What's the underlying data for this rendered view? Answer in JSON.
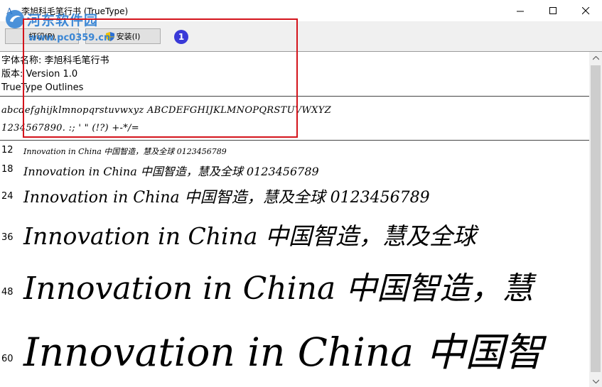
{
  "window": {
    "title": "李旭科毛笔行书 (TrueType)",
    "controls": {
      "minimize": "—",
      "maximize": "☐",
      "close": "✕"
    }
  },
  "watermark": {
    "line1": "河东软件园",
    "line2": "www.pc0359.cn"
  },
  "toolbar": {
    "print_label": "打印(P)",
    "install_label": "安装(I)",
    "badge": "1"
  },
  "font_info": {
    "name_line": "字体名称: 李旭科毛笔行书",
    "version_line": "版本: Version 1.0",
    "type_line": "TrueType Outlines"
  },
  "charset": {
    "line1": "abcdefghijklmnopqrstuvwxyz  ABCDEFGHIJKLMNOPQRSTUVWXYZ",
    "line2": "1234567890.  :;  '  \"  (!?)  +-*/="
  },
  "samples": [
    {
      "size": "12",
      "text": "Innovation in China  中国智造，慧及全球  0123456789"
    },
    {
      "size": "18",
      "text": "Innovation in China  中国智造，慧及全球  0123456789"
    },
    {
      "size": "24",
      "text": "Innovation in China  中国智造，慧及全球  0123456789"
    },
    {
      "size": "36",
      "text": "Innovation in China  中国智造，慧及全球"
    },
    {
      "size": "48",
      "text": "Innovation in China  中国智造，慧"
    },
    {
      "size": "60",
      "text": "Innovation in China  中国智"
    }
  ],
  "colors": {
    "highlight": "#d4141c",
    "badge": "#3a3ad8",
    "watermark": "#2d7fd3"
  }
}
